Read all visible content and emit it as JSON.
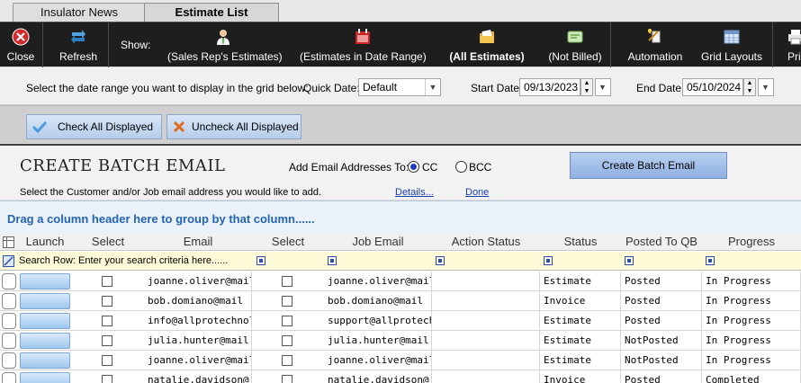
{
  "tabs": [
    {
      "label": "Insulator News"
    },
    {
      "label": "Estimate List"
    }
  ],
  "toolbar": {
    "close_label": "Close",
    "refresh_label": "Refresh",
    "show_label": "Show:",
    "sales_rep_label": "(Sales Rep's Estimates)",
    "date_range_label": "(Estimates in Date Range)",
    "all_estimates_label": "(All Estimates)",
    "not_billed_label": "(Not Billed)",
    "automation_label": "Automation",
    "grid_layouts_label": "Grid Layouts",
    "print_label": "Pri"
  },
  "daterange": {
    "instruction": "Select the date range you want to display in the grid below:",
    "quick_date_label": "Quick Date:",
    "quick_date_value": "Default",
    "start_label": "Start Date:",
    "start_value": "09/13/2023",
    "end_label": "End Date:",
    "end_value": "05/10/2024"
  },
  "check": {
    "check_all": "Check All Displayed",
    "uncheck_all": "Uncheck All Displayed"
  },
  "batch": {
    "title": "CREATE BATCH EMAIL",
    "add_to_label": "Add Email Addresses To:",
    "cc_label": "CC",
    "bcc_label": "BCC",
    "create_button": "Create Batch Email",
    "instruction": "Select the Customer and/or Job email address you would like to add.",
    "details_link": "Details...",
    "done_link": "Done"
  },
  "group_hint": "Drag a column header here to group by that column......",
  "grid": {
    "columns": [
      "Launch",
      "Select",
      "Email",
      "Select",
      "Job Email",
      "Action Status",
      "Status",
      "Posted To QB",
      "Progress"
    ],
    "search_hint": "Search Row: Enter your search criteria here......",
    "rows": [
      {
        "email": "joanne.oliver@mail",
        "job_email": "joanne.oliver@mail",
        "action_status": "",
        "status": "Estimate",
        "posted": "Posted",
        "progress": "In Progress"
      },
      {
        "email": "bob.domiano@mail",
        "job_email": "bob.domiano@mail",
        "action_status": "",
        "status": "Invoice",
        "posted": "Posted",
        "progress": "In Progress"
      },
      {
        "email": "info@allprotechnol",
        "job_email": "support@allprotech",
        "action_status": "",
        "status": "Estimate",
        "posted": "Posted",
        "progress": "In Progress"
      },
      {
        "email": "julia.hunter@mail.c",
        "job_email": "julia.hunter@mail.c",
        "action_status": "",
        "status": "Estimate",
        "posted": "NotPosted",
        "progress": "In Progress"
      },
      {
        "email": "joanne.oliver@mail",
        "job_email": "joanne.oliver@mail",
        "action_status": "",
        "status": "Estimate",
        "posted": "NotPosted",
        "progress": "In Progress"
      },
      {
        "email": "natalie.davidson@",
        "job_email": "natalie.davidson@",
        "action_status": "",
        "status": "Invoice",
        "posted": "Posted",
        "progress": "Completed"
      }
    ]
  },
  "colors": {
    "toolbar_bg": "#1e1e1e",
    "accent_blue": "#2464b4",
    "search_row_bg": "#fffbd8"
  }
}
